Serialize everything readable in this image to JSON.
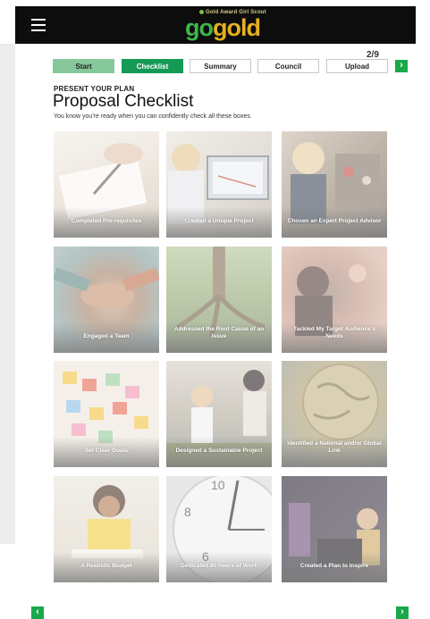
{
  "header": {
    "logo_tagline": "Gold Award Girl Scout",
    "logo_go": "go",
    "logo_gold": "gold"
  },
  "progress": {
    "page_label": "2/9"
  },
  "steps": [
    {
      "label": "Start",
      "state": "done"
    },
    {
      "label": "Checklist",
      "state": "active"
    },
    {
      "label": "Summary",
      "state": "pending"
    },
    {
      "label": "Council",
      "state": "pending"
    },
    {
      "label": "Upload",
      "state": "pending"
    }
  ],
  "main": {
    "kicker": "PRESENT YOUR PLAN",
    "title": "Proposal Checklist",
    "subtitle": "You know you're ready when you can confidently check all these boxes."
  },
  "tiles": [
    {
      "label": "Completed Pre-requisites",
      "icon": "pen-writing-photo"
    },
    {
      "label": "Created a Unique Project",
      "icon": "laptop-photo"
    },
    {
      "label": "Chosen an Expert Project Advisor",
      "icon": "lab-photo"
    },
    {
      "label": "Engaged a Team",
      "icon": "team-hands-photo"
    },
    {
      "label": "Addressed the Root Cause of an Issue",
      "icon": "tree-roots-photo"
    },
    {
      "label": "Tackled My Target Audience's Needs",
      "icon": "audience-photo"
    },
    {
      "label": "Set Clear Goals",
      "icon": "sticky-notes-photo"
    },
    {
      "label": "Designed a Sustainable Project",
      "icon": "garden-photo"
    },
    {
      "label": "Identified a National and/or Global Link",
      "icon": "globe-photo"
    },
    {
      "label": "A Realistic Budget",
      "icon": "budget-photo"
    },
    {
      "label": "Dedicated 80 hours of Work",
      "icon": "clock-photo"
    },
    {
      "label": "Created a Plan to Inspire",
      "icon": "speaker-photo"
    }
  ],
  "nav": {
    "prev_glyph": "‹",
    "next_glyph": "›"
  },
  "colors": {
    "brand_green": "#19a84a",
    "step_active": "#159a55",
    "step_done": "#87c89a",
    "logo_go": "#3fb54a",
    "logo_gold": "#e6b022"
  }
}
